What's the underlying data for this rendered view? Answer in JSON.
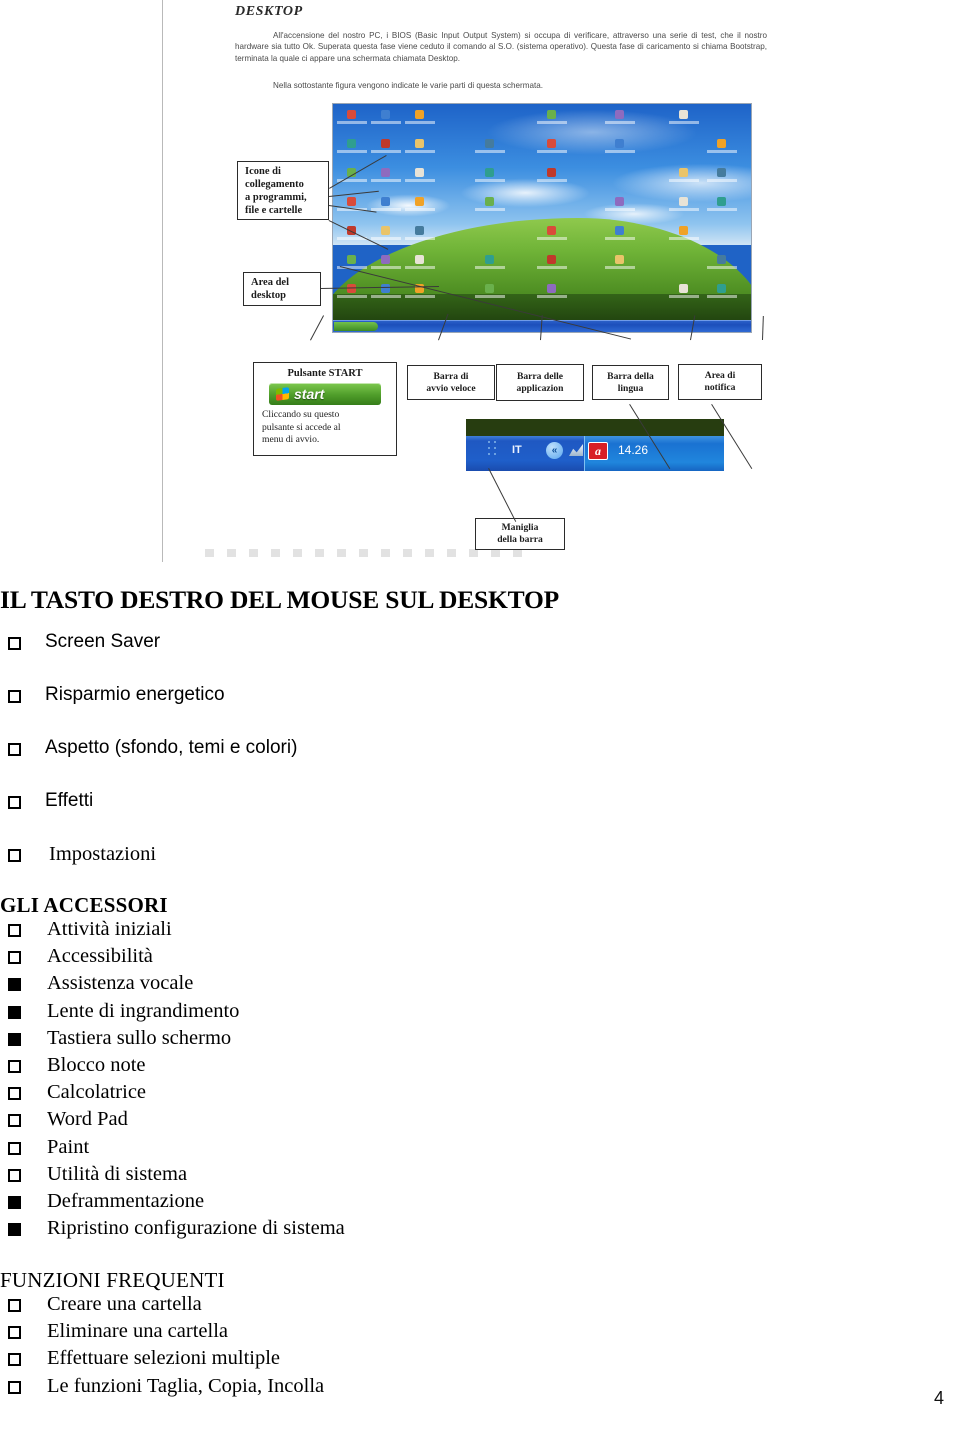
{
  "figure": {
    "heading": "DESKTOP",
    "paragraph_1": "All'accensione del nostro PC, i BIOS (Basic Input Output System) si occupa di verificare, attraverso una serie di test, che il nostro hardware sia tutto Ok. Superata questa fase viene ceduto il comando al S.O. (sistema operativo). Questa fase di caricamento si chiama Bootstrap, terminata la quale ci appare una schermata chiamata Desktop.",
    "paragraph_2": "Nella sottostante figura vengono indicate le varie parti di questa schermata.",
    "callouts": {
      "icone": [
        "Icone di",
        "collegamento",
        "a programmi,",
        "file e cartelle"
      ],
      "area_desktop": [
        "Area del",
        "desktop"
      ],
      "pulsante_start_title": "Pulsante START",
      "pulsante_start_button": "start",
      "pulsante_start_note": [
        "Cliccando su questo",
        "pulsante si accede al",
        "menu di avvio."
      ],
      "barra_avvio_veloce": [
        "Barra di",
        "avvio veloce"
      ],
      "barra_applicazioni": [
        "Barra delle",
        "applicazion"
      ],
      "barra_lingua": [
        "Barra della",
        "lingua"
      ],
      "area_notifica": [
        "Area di",
        "notifica"
      ],
      "maniglia": [
        "Maniglia",
        "della barra"
      ]
    },
    "taskbar": {
      "language_indicator": "IT",
      "chevron": "«",
      "clock": "14.26",
      "antivirus_glyph": "a"
    }
  },
  "document": {
    "title": "IL TASTO DESTRO DEL MOUSE SUL DESKTOP",
    "section_desktop_menu": [
      {
        "label": "Screen Saver",
        "checked": false,
        "font": "sans"
      },
      {
        "label": "Risparmio energetico",
        "checked": false,
        "font": "sans"
      },
      {
        "label": "Aspetto (sfondo, temi e colori)",
        "checked": false,
        "font": "sans"
      },
      {
        "label": "Effetti",
        "checked": false,
        "font": "sans"
      },
      {
        "label": "Impostazioni",
        "checked": false,
        "font": "serif"
      }
    ],
    "section_accessori_heading": "GLI ACCESSORI",
    "section_accessori": [
      {
        "label": "Attività iniziali",
        "checked": false
      },
      {
        "label": "Accessibilità",
        "checked": false
      },
      {
        "label": "Assistenza vocale",
        "checked": true
      },
      {
        "label": "Lente di ingrandimento",
        "checked": true
      },
      {
        "label": "Tastiera sullo schermo",
        "checked": true
      },
      {
        "label": "Blocco note",
        "checked": false
      },
      {
        "label": "Calcolatrice",
        "checked": false
      },
      {
        "label": "Word Pad",
        "checked": false
      },
      {
        "label": "Paint",
        "checked": false
      },
      {
        "label": "Utilità di sistema",
        "checked": false
      },
      {
        "label": "Deframmentazione",
        "checked": true
      },
      {
        "label": "Ripristino configurazione di sistema",
        "checked": true
      }
    ],
    "section_funzioni_heading": "FUNZIONI FREQUENTI",
    "section_funzioni": [
      {
        "label": "Creare una cartella",
        "checked": false
      },
      {
        "label": "Eliminare una cartella",
        "checked": false
      },
      {
        "label": "Effettuare selezioni multiple",
        "checked": false
      },
      {
        "label": "Le funzioni Taglia, Copia, Incolla",
        "checked": false
      }
    ],
    "page_number": "4"
  },
  "colors": {
    "text": "#000000",
    "rule": "#b9b9b9",
    "taskbar_blue": "#1f5fca",
    "start_green": "#4f9d2a"
  }
}
